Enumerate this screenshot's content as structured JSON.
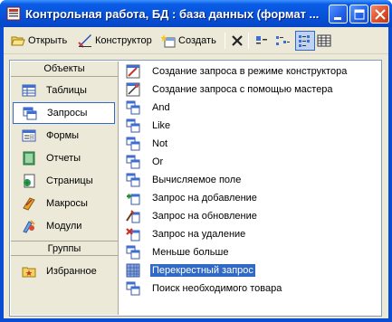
{
  "window": {
    "title": "Контрольная работа, БД : база данных (формат ..."
  },
  "toolbar": {
    "open_label": "Открыть",
    "designer_label": "Конструктор",
    "create_label": "Создать"
  },
  "sidebar": {
    "objects_header": "Объекты",
    "groups_header": "Группы",
    "items": [
      {
        "label": "Таблицы",
        "icon": "table-icon"
      },
      {
        "label": "Запросы",
        "icon": "query-icon",
        "selected": true
      },
      {
        "label": "Формы",
        "icon": "form-icon"
      },
      {
        "label": "Отчеты",
        "icon": "report-icon"
      },
      {
        "label": "Страницы",
        "icon": "page-icon"
      },
      {
        "label": "Макросы",
        "icon": "macro-icon"
      },
      {
        "label": "Модули",
        "icon": "module-icon"
      }
    ],
    "groups": [
      {
        "label": "Избранное",
        "icon": "favorites-icon"
      }
    ]
  },
  "list": {
    "items": [
      {
        "label": "Создание запроса в режиме конструктора",
        "icon": "wizard-design-icon"
      },
      {
        "label": "Создание запроса с помощью мастера",
        "icon": "wizard-icon"
      },
      {
        "label": "And",
        "icon": "select-query-icon"
      },
      {
        "label": "Like",
        "icon": "select-query-icon"
      },
      {
        "label": "Not",
        "icon": "select-query-icon"
      },
      {
        "label": "Or",
        "icon": "select-query-icon"
      },
      {
        "label": "Вычисляемое поле",
        "icon": "select-query-icon"
      },
      {
        "label": "Запрос на добавление",
        "icon": "append-query-icon"
      },
      {
        "label": "Запрос на обновление",
        "icon": "update-query-icon"
      },
      {
        "label": "Запрос на удаление",
        "icon": "delete-query-icon"
      },
      {
        "label": "Меньше больше",
        "icon": "select-query-icon"
      },
      {
        "label": "Перекрестный запрос",
        "icon": "crosstab-query-icon",
        "selected": true
      },
      {
        "label": "Поиск необходимого товара",
        "icon": "select-query-icon"
      }
    ]
  },
  "colors": {
    "titlebar": "#0552d9",
    "selection": "#316ac5",
    "face": "#ece9d8"
  }
}
